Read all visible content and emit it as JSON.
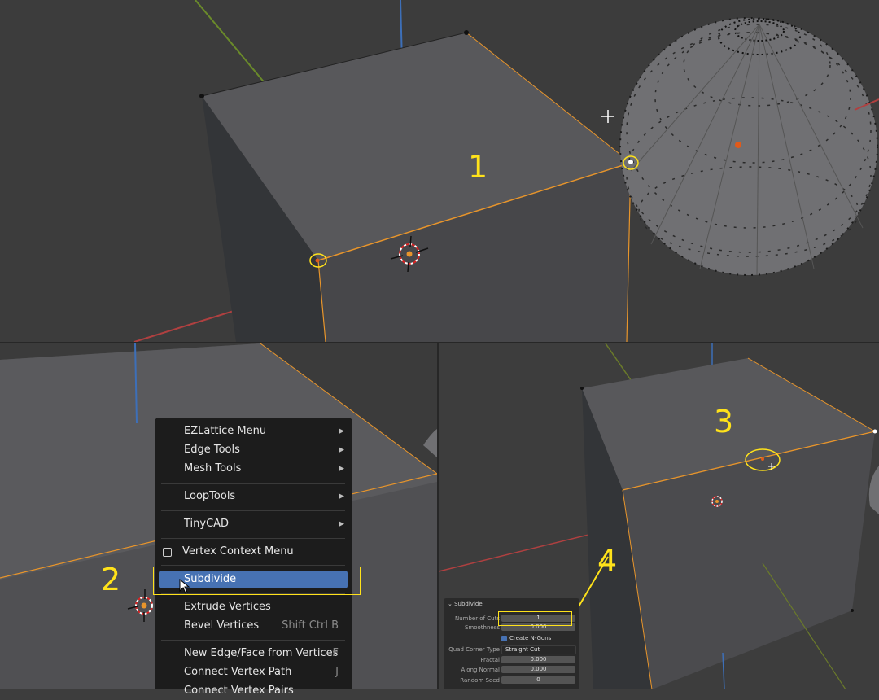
{
  "steps": {
    "one": "1",
    "two": "2",
    "three": "3",
    "four": "4"
  },
  "context_menu": {
    "items": [
      {
        "label": "EZLattice Menu",
        "submenu": true
      },
      {
        "label": "Edge Tools",
        "submenu": true
      },
      {
        "label": "Mesh Tools",
        "submenu": true
      },
      {
        "label": "LoopTools",
        "submenu": true
      },
      {
        "label": "TinyCAD",
        "submenu": true
      },
      {
        "label": "Vertex Context Menu",
        "icon": "menu-icon"
      },
      {
        "label": "Subdivide",
        "highlighted": true
      },
      {
        "label": "Extrude Vertices"
      },
      {
        "label": "Bevel Vertices",
        "shortcut": "Shift Ctrl B"
      },
      {
        "label": "New Edge/Face from Vertices",
        "shortcut": "F"
      },
      {
        "label": "Connect Vertex Path",
        "shortcut": "J"
      },
      {
        "label": "Connect Vertex Pairs"
      }
    ]
  },
  "redo_panel": {
    "title": "Subdivide",
    "number_of_cuts_label": "Number of Cuts",
    "number_of_cuts": "1",
    "smoothness_label": "Smoothness",
    "smoothness": "0.000",
    "create_ngons_label": "Create N-Gons",
    "create_ngons": true,
    "quad_corner_label": "Quad Corner Type",
    "quad_corner": "Straight Cut",
    "fractal_label": "Fractal",
    "fractal": "0.000",
    "along_normal_label": "Along Normal",
    "along_normal": "0.000",
    "random_seed_label": "Random Seed",
    "random_seed": "0"
  },
  "colors": {
    "highlight": "#ffe21a",
    "selection": "#e8952b",
    "menu_active": "#4772b3"
  }
}
